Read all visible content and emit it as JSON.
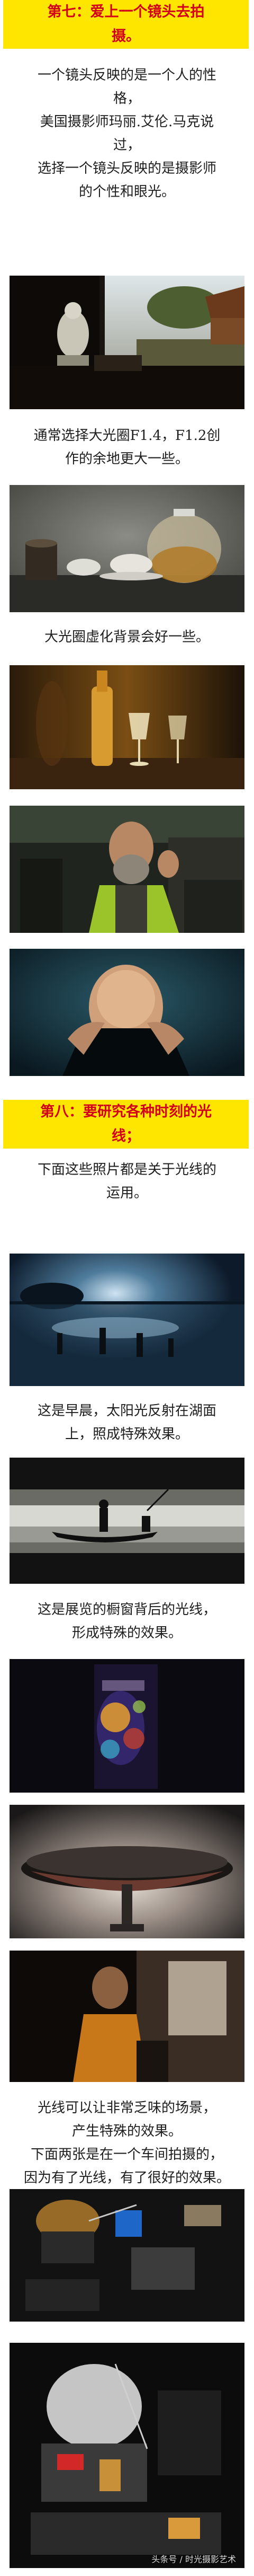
{
  "section7": {
    "heading_line1": "第七：爱上一个镜头去拍",
    "heading_line2": "摄。",
    "para1_lines": [
      "一个镜头反映的是一个人的性",
      "格，",
      "美国摄影师玛丽.艾伦.马克说",
      "过，",
      "选择一个镜头反映的是摄影师",
      "的个性和眼光。"
    ],
    "para2_lines": [
      "通常选择大光圈F1.4，F1.2创",
      "作的余地更大一些。"
    ],
    "para3": "大光圈虚化背景会好一些。"
  },
  "section8": {
    "heading_line1": "第八：要研究各种时刻的光",
    "heading_line2": "线；",
    "para1_lines": [
      "下面这些照片都是关于光线的",
      "运用。"
    ],
    "para2_lines": [
      "这是早晨，太阳光反射在湖面",
      "上，照成特殊效果。"
    ],
    "para3_lines": [
      "这是展览的橱窗背后的光线，",
      "形成特殊的效果。"
    ],
    "para4_lines": [
      "光线可以让非常乏味的场景，",
      "产生特殊的效果。",
      "下面两张是在一个车间拍摄的，",
      "因为有了光线，有了很好的效果。"
    ]
  },
  "watermark": "头条号 / 时光摄影艺术"
}
